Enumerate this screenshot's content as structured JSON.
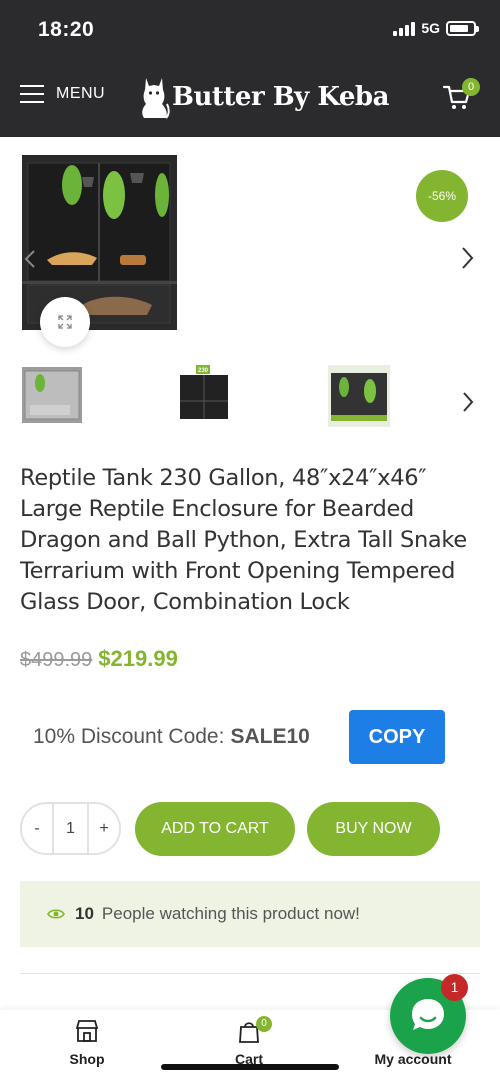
{
  "status_bar": {
    "time": "18:20",
    "network": "5G",
    "icons": [
      "signal-icon",
      "battery-icon"
    ]
  },
  "header": {
    "menu_label": "MENU",
    "brand": "Butter By Keba",
    "cart_count": "0",
    "icons": [
      "menu-icon",
      "cat-logo-icon",
      "cart-icon"
    ]
  },
  "gallery": {
    "sale_badge": "-56%",
    "icons": [
      "chevron-left-icon",
      "chevron-right-icon",
      "expand-icon"
    ],
    "thumbnail_badge": "230"
  },
  "product": {
    "title": "Reptile Tank 230 Gallon, 48″x24″x46″ Large Reptile Enclosure for Bearded Dragon and Ball Python, Extra Tall Snake Terrarium with Front Opening Tempered Glass Door, Combination Lock",
    "price_old": "$499.99",
    "price_new": "$219.99"
  },
  "discount": {
    "label": "10% Discount Code:",
    "code": "SALE10",
    "copy_label": "COPY"
  },
  "purchase": {
    "qty_minus": "-",
    "qty_value": "1",
    "qty_plus": "+",
    "add_to_cart": "ADD TO CART",
    "buy_now": "BUY NOW"
  },
  "watching": {
    "count": "10",
    "text": "People watching this product now!",
    "icon": "eye-icon"
  },
  "bottom_nav": {
    "items": [
      {
        "label": "Shop",
        "icon": "shop-icon"
      },
      {
        "label": "Cart",
        "icon": "bag-icon",
        "badge": "0"
      },
      {
        "label": "My account",
        "icon": "user-icon"
      }
    ]
  },
  "chat": {
    "badge": "1",
    "icon": "chat-icon"
  },
  "colors": {
    "header_bg": "#2b2b2d",
    "accent_green": "#84b531",
    "copy_blue": "#1d7fe6",
    "chat_green": "#1aa34a",
    "badge_red": "#c62828"
  }
}
